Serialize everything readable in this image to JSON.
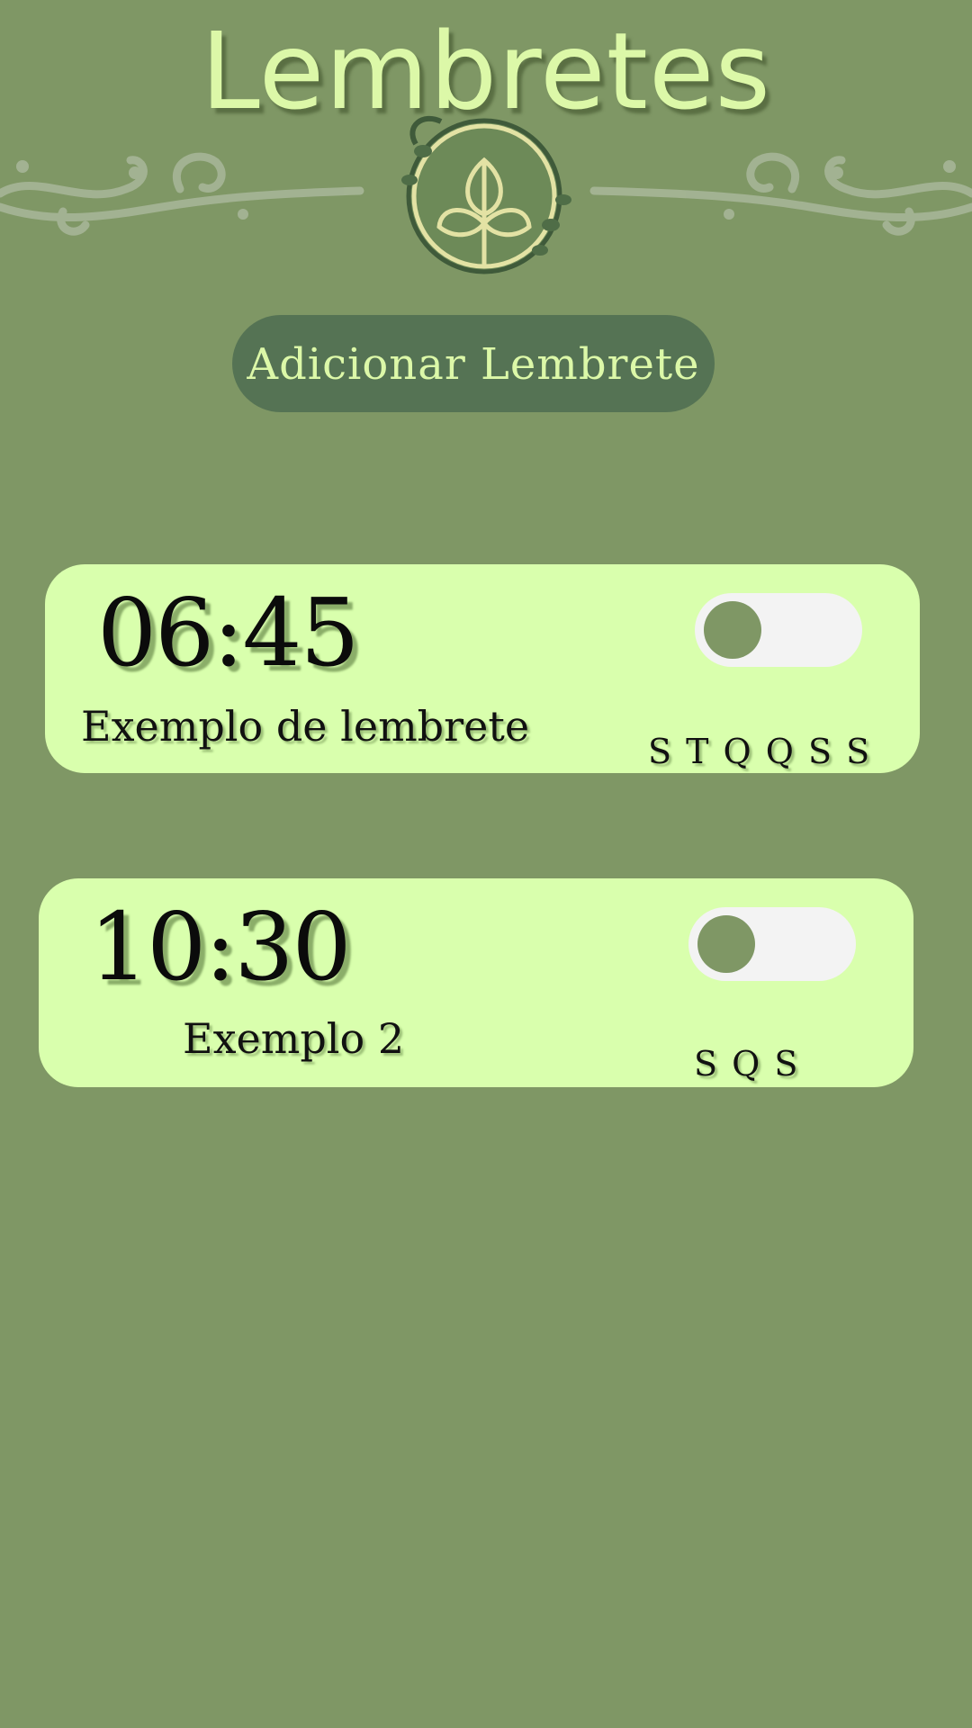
{
  "header": {
    "title": "Lembretes"
  },
  "toolbar": {
    "add_label": "Adicionar Lembrete"
  },
  "reminders": [
    {
      "time": "06:45",
      "label": "Exemplo de lembrete",
      "days": "S T Q Q S S",
      "enabled": false
    },
    {
      "time": "10:30",
      "label": "Exemplo 2",
      "days": "S Q S",
      "enabled": false
    }
  ],
  "icons": {
    "logo": "leaf-sprout-icon",
    "ornament": "swirl-ornament"
  },
  "colors": {
    "background": "#7f9765",
    "accent_text": "#dcf8a8",
    "card": "#d9ffad",
    "button": "#557354",
    "toggle_track": "#f3f3f3"
  }
}
